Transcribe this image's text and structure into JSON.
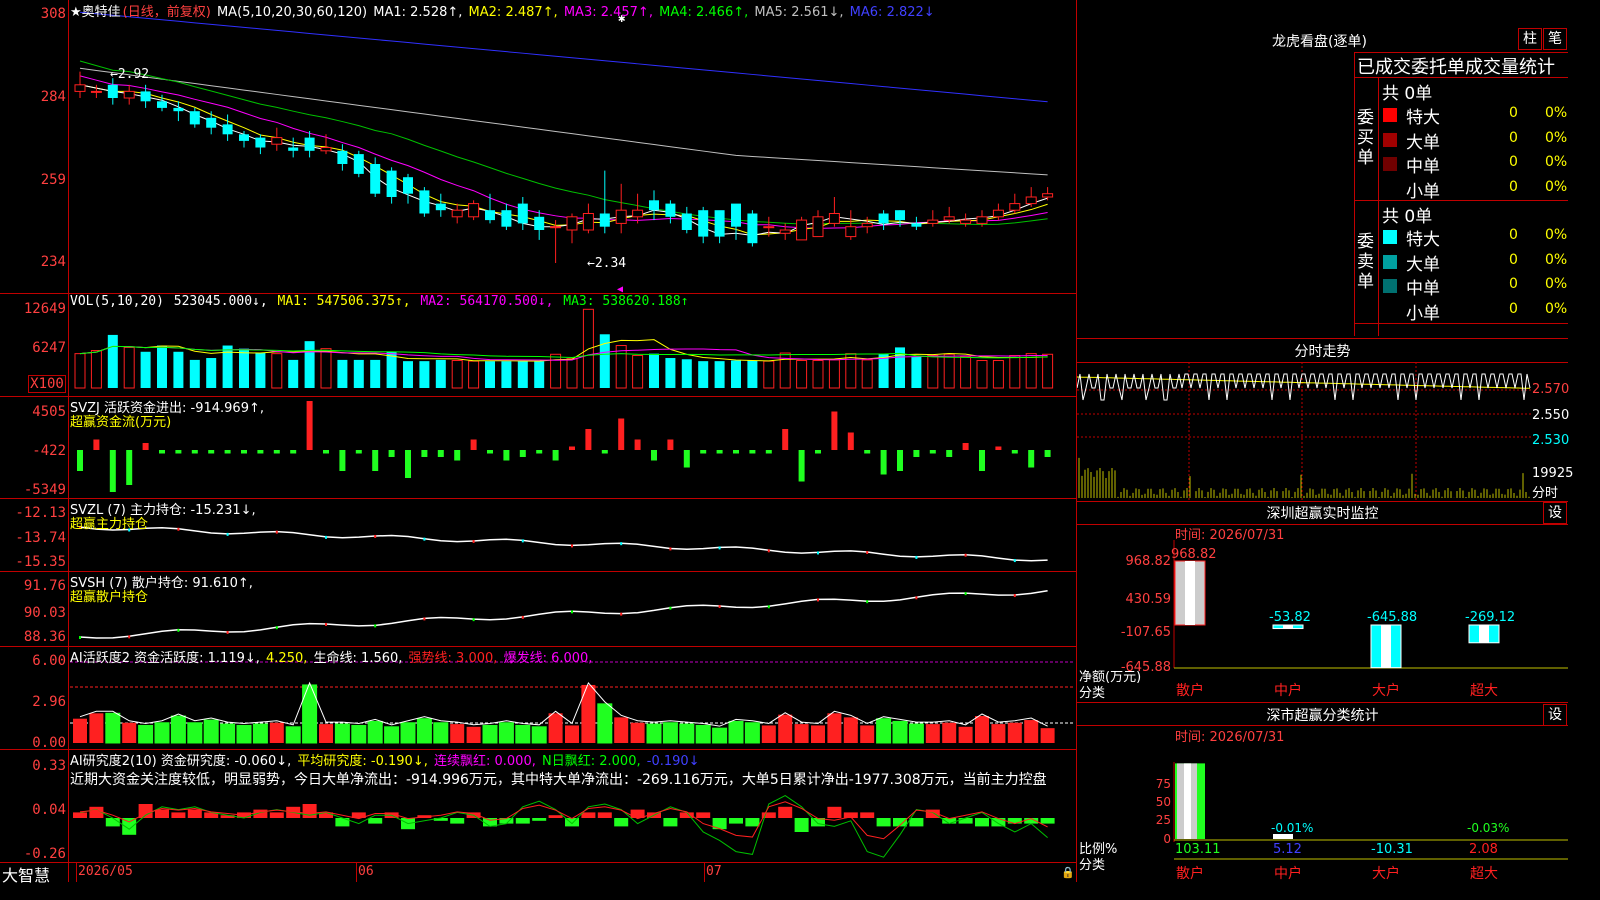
{
  "main": {
    "stock_title": "★奥特佳",
    "period": "(日线，前复权)",
    "ma_params": "MA(5,10,20,30,60,120)",
    "ma_values": [
      {
        "label": "MA1: 2.528↑,",
        "color": "#ffffff"
      },
      {
        "label": "MA2: 2.487↑,",
        "color": "#ffff00"
      },
      {
        "label": "MA3: 2.457↑,",
        "color": "#ff00ff"
      },
      {
        "label": "MA4: 2.466↑,",
        "color": "#00ff00"
      },
      {
        "label": "MA5: 2.561↓,",
        "color": "#c0c0c0"
      },
      {
        "label": "MA6: 2.822↓",
        "color": "#4040ff"
      }
    ],
    "y_ticks": [
      "308",
      "284",
      "259",
      "234"
    ],
    "high_label": "←2.92",
    "low_label": "←2.34"
  },
  "vol": {
    "legend_name": "VOL(5,10,20)",
    "legend_value": "523045.000↓,",
    "ma1": "MA1: 547506.375↑,",
    "ma2": "MA2: 564170.500↓,",
    "ma3": "MA3: 538620.188↑",
    "y_ticks": [
      "12649",
      "6247",
      "X100"
    ]
  },
  "svzj": {
    "legend": "SVZJ  活跃资金进出: -914.969↑,",
    "sub": "超赢资金流(万元)",
    "y_ticks": [
      "4505",
      "-422",
      "-5349"
    ]
  },
  "svzl": {
    "legend": "SVZL (7) 主力持仓: -15.231↓,",
    "sub": "超赢主力持仓",
    "y_ticks": [
      "-12.13",
      "-13.74",
      "-15.35"
    ]
  },
  "svsh": {
    "legend": "SVSH (7) 散户持仓: 91.610↑,",
    "sub": "超赢散户持仓",
    "y_ticks": [
      "91.76",
      "90.03",
      "88.36"
    ]
  },
  "ai1": {
    "legend_a": "AI活跃度2 资金活跃度: 1.119↓,",
    "legend_b": "4.250,",
    "legend_c": "生命线: 1.560,",
    "legend_d": "强势线: 3.000,",
    "legend_e": "爆发线: 6.000,",
    "y_ticks": [
      "6.00",
      "2.96",
      "0.00"
    ]
  },
  "ai2": {
    "legend_a": "AI研究度2(10) 资金研究度: -0.060↓,",
    "legend_b": "平均研究度: -0.190↓,",
    "legend_c": "连续飘红: 0.000,",
    "legend_d": "N日飘红: 2.000,",
    "legend_e": "-0.190↓",
    "comment": "近期大资金关注度较低，明显弱势，今日大单净流出：-914.996万元，其中特大单净流出：-269.116万元，大单5日累计净出-1977.308万元，当前主力控盘",
    "y_ticks": [
      "0.33",
      "0.04",
      "-0.26"
    ]
  },
  "date_axis": {
    "brand": "大智慧",
    "dates": [
      "2026/05",
      "06",
      "07"
    ]
  },
  "right": {
    "lhb_title": "龙虎看盘(逐单)",
    "btn_zhu": "柱",
    "btn_bi": "笔",
    "tabs": "已成交委托单成交量统计",
    "buy_label": "委买单",
    "sell_label": "委卖单",
    "buy_total": "共 0单",
    "sell_total": "共 0单",
    "buy_rows": [
      {
        "name": "特大",
        "count": "0",
        "pct": "0%",
        "color": "#ff0000"
      },
      {
        "name": "大单",
        "count": "0",
        "pct": "0%",
        "color": "#a00000"
      },
      {
        "name": "中单",
        "count": "0",
        "pct": "0%",
        "color": "#700000"
      },
      {
        "name": "小单",
        "count": "0",
        "pct": "0%",
        "color": "#000000"
      }
    ],
    "sell_rows": [
      {
        "name": "特大",
        "count": "0",
        "pct": "0%",
        "color": "#00ffff"
      },
      {
        "name": "大单",
        "count": "0",
        "pct": "0%",
        "color": "#00a0a0"
      },
      {
        "name": "中单",
        "count": "0",
        "pct": "0%",
        "color": "#007070"
      },
      {
        "name": "小单",
        "count": "0",
        "pct": "0%",
        "color": "#000000"
      }
    ],
    "fenshi_title": "分时走势",
    "fenshi_ticks": [
      "2.570",
      "2.550",
      "2.530",
      "19925",
      "分时"
    ],
    "monitor_title": "深圳超赢实时监控",
    "monitor_set": "设",
    "monitor_time": "时间: 2026/07/31",
    "monitor_ticks": [
      "968.82",
      "430.59",
      "-107.65",
      "-645.88"
    ],
    "monitor_unit_a": "净额(万元)",
    "monitor_unit_b": "分类",
    "monitor_values": [
      "968.82",
      "-53.82",
      "-645.88",
      "-269.12"
    ],
    "monitor_cats": [
      "散户",
      "中户",
      "大户",
      "超大"
    ],
    "stat_title": "深市超赢分类统计",
    "stat_set": "设",
    "stat_time": "时间: 2026/07/31",
    "stat_ticks": [
      "75",
      "50",
      "25",
      "0"
    ],
    "stat_unit_a": "比例%",
    "stat_unit_b": "分类",
    "stat_labels": [
      "",
      "-0.01%",
      "",
      "-0.03%"
    ],
    "stat_values": [
      "103.11",
      "5.12",
      "-10.31",
      "2.08"
    ],
    "stat_cats": [
      "散户",
      "中户",
      "大户",
      "超大"
    ]
  },
  "colors": {
    "up": "#ff2020",
    "down": "#00ffff",
    "grid": "#c00000",
    "axis": "#ff4040"
  },
  "chart_data": [
    {
      "type": "candlestick",
      "title": "奥特佳 (日线，前复权)",
      "x": [
        1,
        2,
        3,
        4,
        5,
        6,
        7,
        8,
        9,
        10,
        11,
        12,
        13,
        14,
        15,
        16,
        17,
        18,
        19,
        20,
        21,
        22,
        23,
        24,
        25,
        26,
        27,
        28,
        29,
        30,
        31,
        32,
        33,
        34,
        35,
        36,
        37,
        38,
        39,
        40,
        41,
        42,
        43,
        44,
        45,
        46,
        47,
        48,
        49,
        50,
        51,
        52,
        53,
        54,
        55,
        56,
        57,
        58,
        59,
        60
      ],
      "open": [
        2.86,
        2.86,
        2.88,
        2.84,
        2.86,
        2.83,
        2.81,
        2.8,
        2.78,
        2.76,
        2.73,
        2.72,
        2.7,
        2.69,
        2.72,
        2.68,
        2.68,
        2.67,
        2.64,
        2.62,
        2.6,
        2.56,
        2.52,
        2.48,
        2.48,
        2.5,
        2.5,
        2.52,
        2.48,
        2.45,
        2.44,
        2.44,
        2.49,
        2.46,
        2.48,
        2.53,
        2.52,
        2.49,
        2.5,
        2.5,
        2.52,
        2.49,
        2.45,
        2.43,
        2.41,
        2.42,
        2.46,
        2.42,
        2.45,
        2.49,
        2.5,
        2.46,
        2.46,
        2.47,
        2.46,
        2.46,
        2.48,
        2.5,
        2.52,
        2.54
      ],
      "close": [
        2.88,
        2.86,
        2.84,
        2.86,
        2.83,
        2.81,
        2.8,
        2.76,
        2.75,
        2.73,
        2.71,
        2.69,
        2.72,
        2.68,
        2.68,
        2.69,
        2.64,
        2.61,
        2.55,
        2.54,
        2.55,
        2.49,
        2.5,
        2.5,
        2.52,
        2.47,
        2.45,
        2.46,
        2.44,
        2.45,
        2.48,
        2.49,
        2.45,
        2.5,
        2.5,
        2.5,
        2.48,
        2.44,
        2.42,
        2.42,
        2.45,
        2.4,
        2.45,
        2.44,
        2.47,
        2.48,
        2.49,
        2.45,
        2.46,
        2.46,
        2.47,
        2.45,
        2.47,
        2.48,
        2.47,
        2.48,
        2.5,
        2.52,
        2.54,
        2.55
      ],
      "high": [
        2.92,
        2.88,
        2.9,
        2.88,
        2.88,
        2.85,
        2.83,
        2.81,
        2.8,
        2.79,
        2.74,
        2.73,
        2.75,
        2.72,
        2.74,
        2.73,
        2.7,
        2.68,
        2.66,
        2.63,
        2.61,
        2.57,
        2.55,
        2.52,
        2.53,
        2.55,
        2.52,
        2.54,
        2.5,
        2.47,
        2.49,
        2.52,
        2.62,
        2.58,
        2.55,
        2.56,
        2.53,
        2.51,
        2.51,
        2.46,
        2.48,
        2.5,
        2.48,
        2.46,
        2.48,
        2.5,
        2.54,
        2.5,
        2.48,
        2.5,
        2.5,
        2.48,
        2.5,
        2.51,
        2.49,
        2.5,
        2.52,
        2.55,
        2.57,
        2.57
      ],
      "low": [
        2.84,
        2.84,
        2.82,
        2.82,
        2.81,
        2.8,
        2.77,
        2.75,
        2.73,
        2.71,
        2.69,
        2.67,
        2.68,
        2.66,
        2.66,
        2.67,
        2.62,
        2.6,
        2.54,
        2.52,
        2.52,
        2.48,
        2.48,
        2.46,
        2.47,
        2.46,
        2.44,
        2.44,
        2.41,
        2.34,
        2.4,
        2.43,
        2.43,
        2.43,
        2.46,
        2.47,
        2.46,
        2.43,
        2.4,
        2.4,
        2.41,
        2.39,
        2.42,
        2.41,
        2.43,
        2.44,
        2.45,
        2.41,
        2.43,
        2.44,
        2.45,
        2.44,
        2.45,
        2.46,
        2.45,
        2.45,
        2.47,
        2.49,
        2.51,
        2.53
      ]
    },
    {
      "type": "bar",
      "title": "VOL(5,10,20)",
      "values": [
        5500,
        6000,
        8500,
        6500,
        5800,
        6800,
        5800,
        4500,
        4800,
        6800,
        6300,
        5600,
        5500,
        4500,
        7500,
        6300,
        4500,
        4500,
        4500,
        5800,
        4300,
        4300,
        4500,
        4400,
        4300,
        4300,
        4300,
        4300,
        4300,
        5400,
        4700,
        12600,
        8600,
        6800,
        5200,
        5500,
        4800,
        4600,
        4300,
        4300,
        4400,
        4400,
        4300,
        5600,
        4400,
        4400,
        4500,
        5500,
        4500,
        5500,
        6500,
        5000,
        5200,
        5400,
        5000,
        4400,
        4400,
        5200,
        5500,
        5400
      ],
      "ylim": [
        0,
        12649
      ]
    }
  ]
}
